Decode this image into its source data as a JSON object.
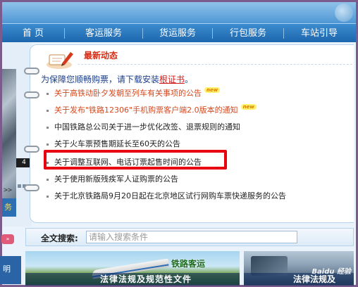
{
  "nav": {
    "items": [
      {
        "label": "首 页"
      },
      {
        "label": "客运服务"
      },
      {
        "label": "货运服务"
      },
      {
        "label": "行包服务"
      },
      {
        "label": "车站引导"
      }
    ]
  },
  "panel": {
    "title": "最新动态",
    "notice_prefix": "为保障您顺畅购票，请下载安装",
    "notice_link": "根证书",
    "notice_suffix": "。",
    "items": [
      {
        "text": "关于高铁动卧夕发朝至列车有关事项的公告",
        "color": "#d4491e",
        "badge": "new"
      },
      {
        "text": "关于发布\"铁路12306\"手机购票客户端2.0版本的通知",
        "color": "#d4491e",
        "badge": "new"
      },
      {
        "text": "中国铁路总公司关于进一步优化改签、退票规则的通知",
        "color": "#222222",
        "badge": ""
      },
      {
        "text": "关于火车票预售期延长至60天的公告",
        "color": "#222222",
        "badge": ""
      },
      {
        "text": "关于调整互联网、电话订票起售时间的公告",
        "color": "#222222",
        "badge": ""
      },
      {
        "text": "关于使用新版残疾军人证购票的公告",
        "color": "#222222",
        "badge": ""
      },
      {
        "text": "关于北京铁路局9月20日起在北京地区试行网购车票快递服务的公告",
        "color": "#222222",
        "badge": ""
      }
    ]
  },
  "left": {
    "badge": "4",
    "arrows": ">>",
    "tab": "务",
    "pink": "»"
  },
  "search": {
    "label": "全文搜索:",
    "placeholder": "请输入搜索条件"
  },
  "banners": {
    "left_text": "明",
    "mid_title": "铁路客运",
    "mid_caption": "法律法规及规范性文件",
    "right_caption": "法律法规及"
  },
  "watermark": "Baidu 经验",
  "colors": {
    "nav_bg": "#1c66ad",
    "highlight": "#e60012",
    "title": "#d62b12",
    "link": "#d21a1a"
  }
}
